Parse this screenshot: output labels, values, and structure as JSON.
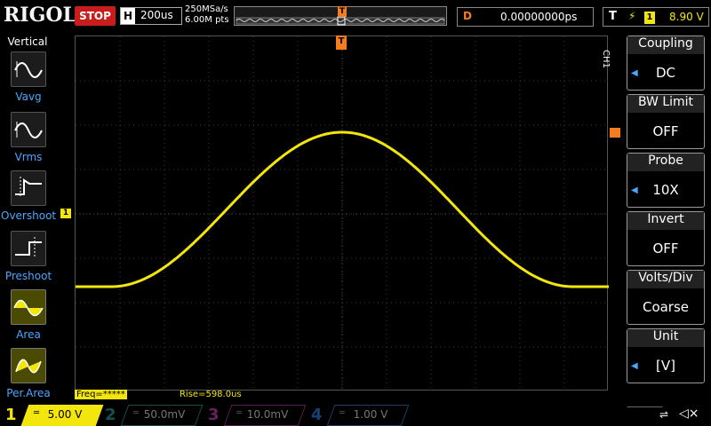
{
  "header": {
    "logo": "RIGOL",
    "run_state": "STOP",
    "horizontal": {
      "label": "H",
      "value": "200us"
    },
    "sample_rate": "250MSa/s",
    "memory_depth": "6.00M pts",
    "delay": {
      "label": "D",
      "value": "0.00000000ps"
    },
    "trigger": {
      "label": "T",
      "icon": "rising-edge-icon",
      "channel": "1",
      "level": "8.90 V"
    },
    "trigger_position_marker": "T"
  },
  "left_panel": {
    "title": "Vertical",
    "items": [
      {
        "label": "Vavg",
        "icon": "vavg-icon"
      },
      {
        "label": "Vrms",
        "icon": "vrms-icon"
      },
      {
        "label": "Overshoot",
        "icon": "overshoot-icon"
      },
      {
        "label": "Preshoot",
        "icon": "preshoot-icon"
      },
      {
        "label": "Area",
        "icon": "area-icon"
      },
      {
        "label": "Per.Area",
        "icon": "per-area-icon"
      }
    ]
  },
  "screen": {
    "channel_marker": "1",
    "measurements": {
      "freq": "Freq=*****",
      "rise": "Rise=598.0us"
    }
  },
  "right_panel": {
    "tab": "CH1",
    "menu": [
      {
        "title": "Coupling",
        "value": "DC",
        "has_arrow": true
      },
      {
        "title": "BW Limit",
        "value": "OFF",
        "has_arrow": false
      },
      {
        "title": "Probe",
        "value": "10X",
        "has_arrow": true
      },
      {
        "title": "Invert",
        "value": "OFF",
        "has_arrow": false
      },
      {
        "title": "Volts/Div",
        "value": "Coarse",
        "has_arrow": false
      },
      {
        "title": "Unit",
        "value": "[V]",
        "has_arrow": true
      }
    ]
  },
  "channels": [
    {
      "number": "1",
      "scale": "5.00 V",
      "color": "#f3e60c",
      "active": true
    },
    {
      "number": "2",
      "scale": "50.0mV",
      "color": "#1fa7a0",
      "active": false
    },
    {
      "number": "3",
      "scale": "10.0mV",
      "color": "#d63fc4",
      "active": false
    },
    {
      "number": "4",
      "scale": "1.00 V",
      "color": "#2f7fe0",
      "active": false
    }
  ],
  "colors": {
    "ch1": "#f3e60c",
    "accent": "#f47d20",
    "menu_label": "#4da6ff"
  }
}
